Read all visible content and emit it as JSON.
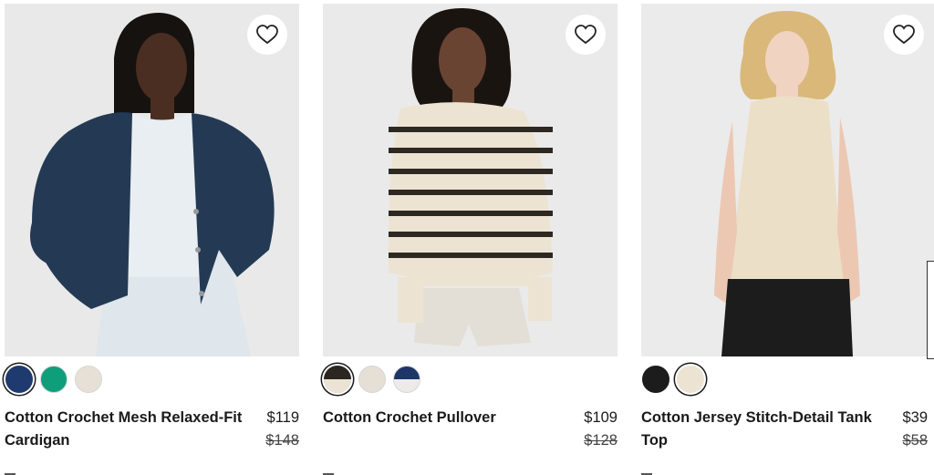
{
  "products": [
    {
      "name": "Cotton Crochet Mesh Relaxed-Fit Cardigan",
      "price": "$119",
      "original_price": "$148",
      "favorite_icon": "heart-outline-icon",
      "swatches": [
        {
          "color": "#1f3a6e",
          "selected": true
        },
        {
          "color": "#0e9f7a",
          "selected": false
        },
        {
          "color": "#e7e0d6",
          "selected": false
        }
      ]
    },
    {
      "name": "Cotton Crochet Pullover",
      "price": "$109",
      "original_price": "$128",
      "favorite_icon": "heart-outline-icon",
      "swatches": [
        {
          "colors": [
            "#2b2620",
            "#ece3d4"
          ],
          "selected": true
        },
        {
          "color": "#e6dfd5",
          "selected": false
        },
        {
          "colors": [
            "#1e3568",
            "#ecebe9"
          ],
          "selected": false
        }
      ]
    },
    {
      "name": "Cotton Jersey Stitch-Detail Tank Top",
      "price": "$39",
      "original_price": "$58",
      "favorite_icon": "heart-outline-icon",
      "swatches": [
        {
          "color": "#1c1c1c",
          "selected": false
        },
        {
          "color": "#ece3d3",
          "selected": true
        }
      ]
    }
  ]
}
